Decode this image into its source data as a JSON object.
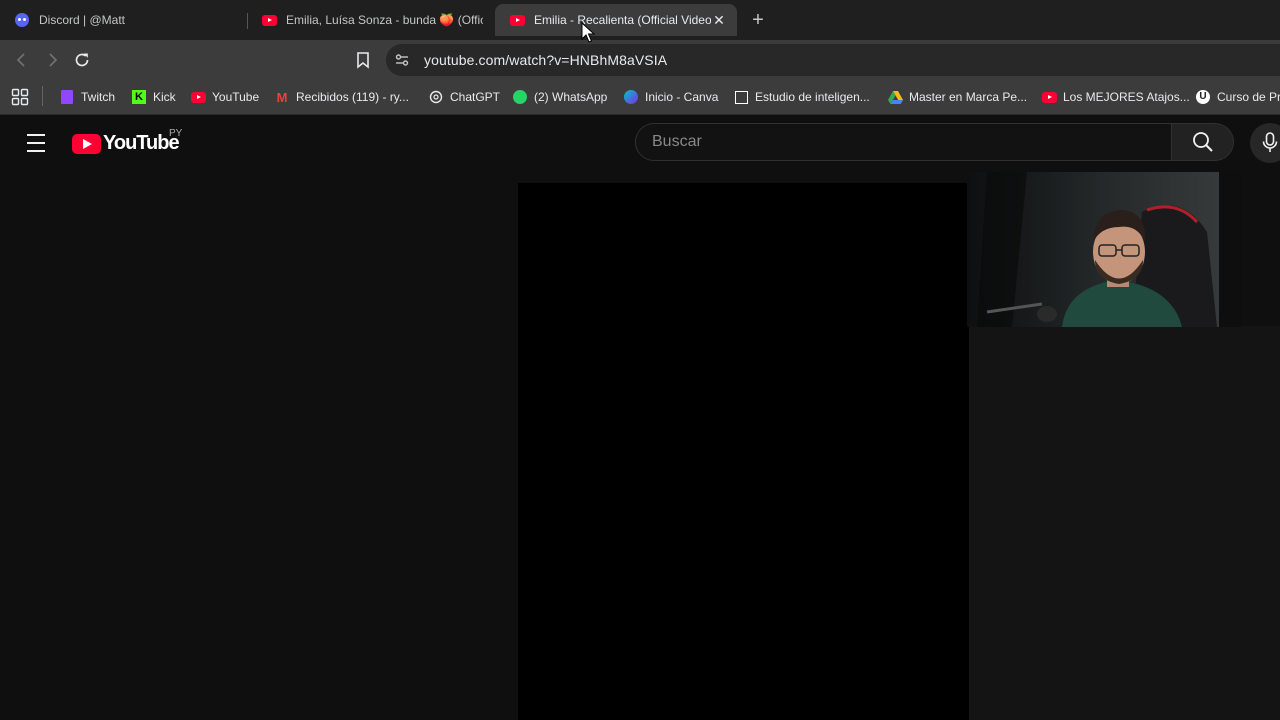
{
  "tabs": [
    {
      "title": "Discord | @Matt",
      "icon": "discord-icon",
      "active": false
    },
    {
      "title": "Emilia, Luísa Sonza - bunda 🍑 (Offic",
      "icon": "youtube-icon",
      "active": false
    },
    {
      "title": "Emilia - Recalienta (Official Video",
      "icon": "youtube-icon",
      "active": true
    }
  ],
  "toolbar": {
    "url": "youtube.com/watch?v=HNBhM8aVSIA"
  },
  "bookmarks": [
    {
      "label": "Twitch",
      "icon": "twitch-icon",
      "color": "#9146ff"
    },
    {
      "label": "Kick",
      "icon": "kick-icon",
      "color": "#53fc18"
    },
    {
      "label": "YouTube",
      "icon": "youtube-icon",
      "color": "#ff0033"
    },
    {
      "label": "Recibidos (119) - ry...",
      "icon": "gmail-icon",
      "color": "#ea4335"
    },
    {
      "label": "ChatGPT",
      "icon": "chatgpt-icon",
      "color": "#e8eaed"
    },
    {
      "label": "(2) WhatsApp",
      "icon": "whatsapp-icon",
      "color": "#25d366"
    },
    {
      "label": "Inicio - Canva",
      "icon": "canva-icon",
      "color": "#00c4cc"
    },
    {
      "label": "Estudio de inteligen...",
      "icon": "ai-studio-icon",
      "color": "#ffffff"
    },
    {
      "label": "Master en Marca Pe...",
      "icon": "google-drive-icon",
      "color": "#fbbc04"
    },
    {
      "label": "Los MEJORES Atajos...",
      "icon": "youtube-icon",
      "color": "#ff0033"
    },
    {
      "label": "Curso de Pr",
      "icon": "udemy-icon",
      "color": "#ffffff"
    }
  ],
  "youtube": {
    "logo_text": "YouTube",
    "country_code": "PY",
    "search_placeholder": "Buscar"
  }
}
